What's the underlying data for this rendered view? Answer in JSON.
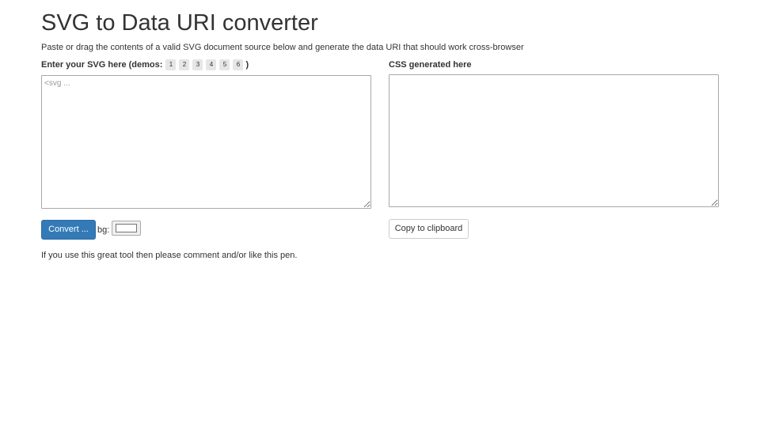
{
  "page": {
    "title": "SVG to Data URI converter",
    "subtitle": "Paste or drag the contents of a valid SVG document source below and generate the data URI that should work cross-browser"
  },
  "input_panel": {
    "label": "Enter your SVG here (demos:",
    "label_close": ")",
    "demos": [
      "1",
      "2",
      "3",
      "4",
      "5",
      "6"
    ],
    "placeholder": "<svg ...",
    "value": ""
  },
  "output_panel": {
    "label": "CSS generated here",
    "value": ""
  },
  "controls": {
    "convert_label": "Convert ...",
    "bg_label": "bg:",
    "bg_color": "#ffffff",
    "copy_label": "Copy to clipboard"
  },
  "footer": {
    "note": "If you use this great tool then please comment and/or like this pen."
  },
  "colors": {
    "primary": "#337ab7",
    "text": "#333333"
  }
}
